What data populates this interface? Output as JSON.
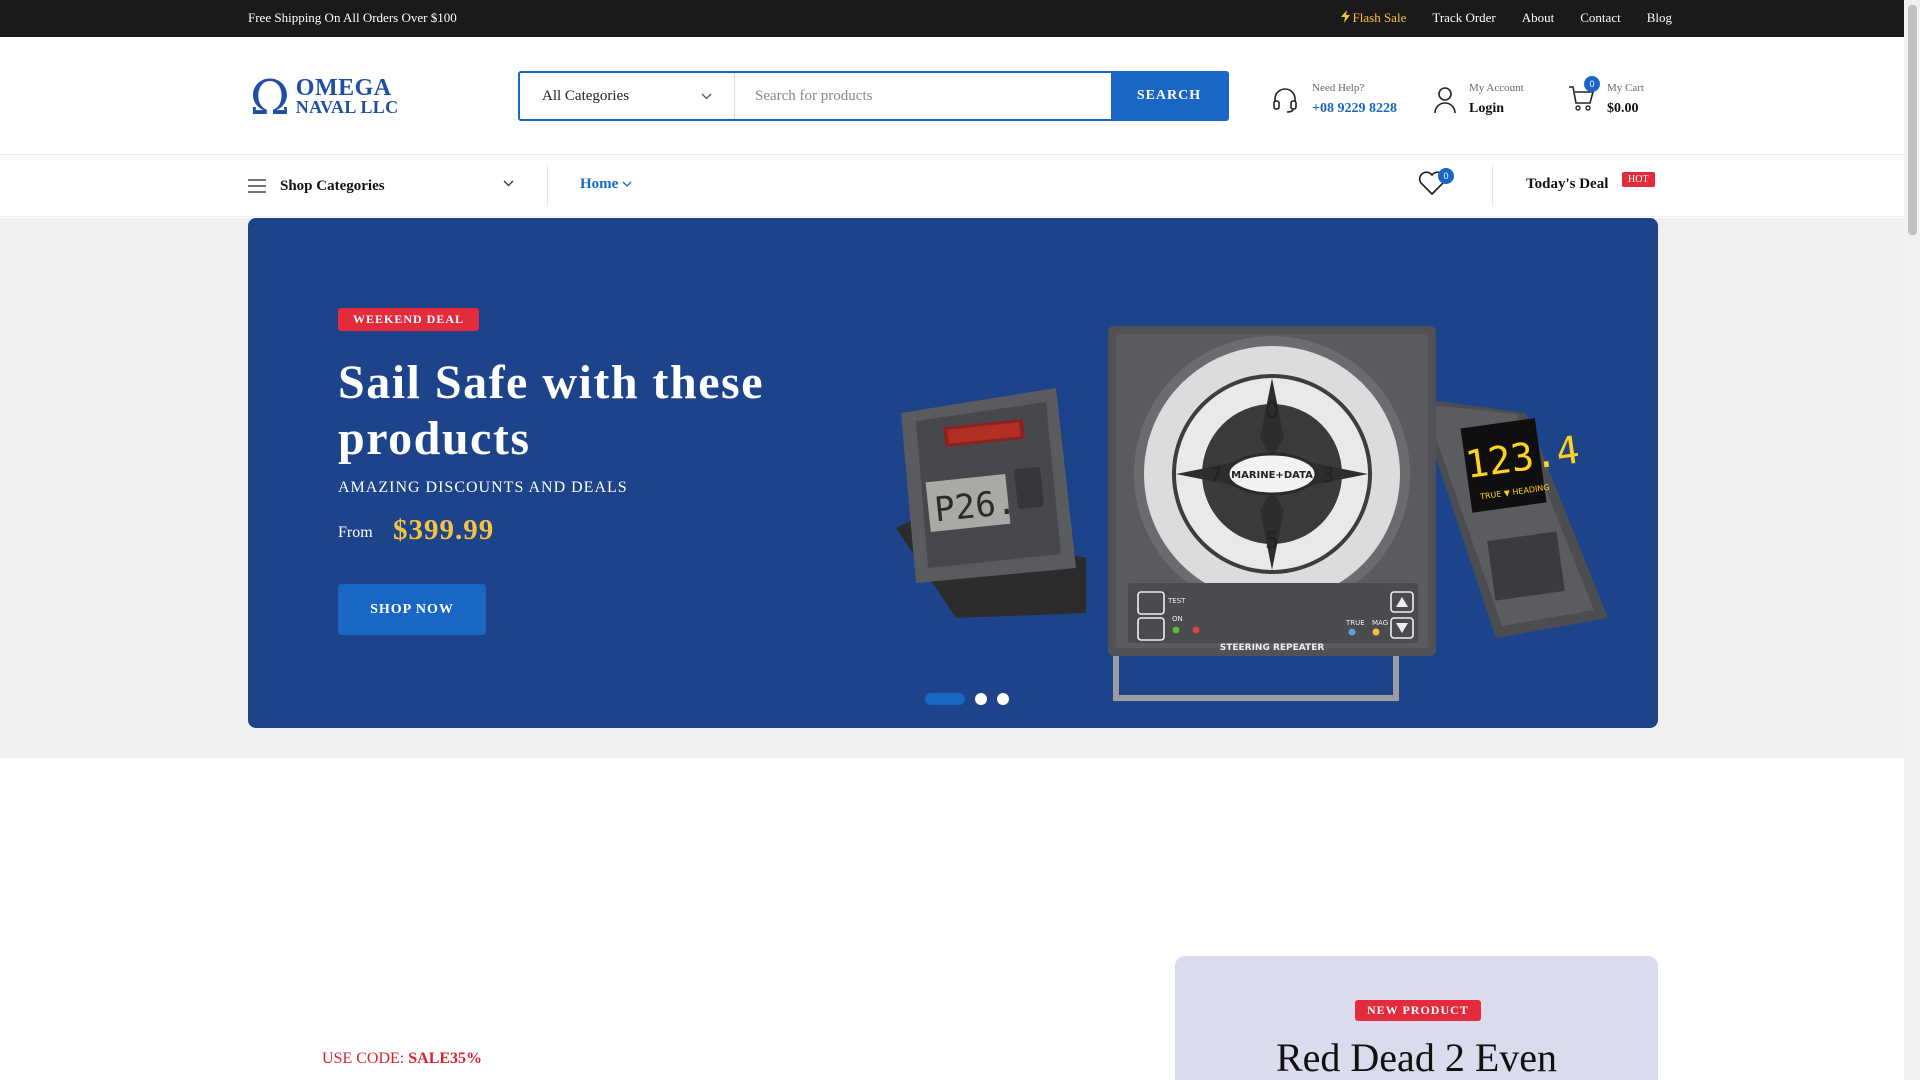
{
  "topbar": {
    "shipping": "Free Shipping On All Orders Over $100",
    "links": [
      "Flash Sale",
      "Track Order",
      "About",
      "Contact",
      "Blog"
    ]
  },
  "logo": {
    "line1": "OMEGA",
    "line2": "NAVAL LLC"
  },
  "search": {
    "category": "All Categories",
    "placeholder": "Search for products",
    "button": "SEARCH"
  },
  "help": {
    "label": "Need Help?",
    "phone": "+08 9229 8228"
  },
  "account": {
    "label": "My Account",
    "action": "Login"
  },
  "cart": {
    "label": "My Cart",
    "total": "$0.00",
    "count": "0"
  },
  "nav": {
    "shop_categories": "Shop Categories",
    "home": "Home",
    "wishlist_count": "0",
    "todays_deal": "Today's Deal",
    "hot": "HOT"
  },
  "hero": {
    "tag": "WEEKEND DEAL",
    "title": "Sail Safe with these products",
    "subtitle": "AMAZING DISCOUNTS AND DEALS",
    "from": "From",
    "price": "$399.99",
    "button": "SHOP NOW",
    "slide_count": 3,
    "active_slide": 1,
    "device": {
      "left_display": "P26.",
      "compass_brand": "MARINE+DATA",
      "compass_label": "STEERING REPEATER",
      "compass_test": "TEST",
      "compass_on": "ON",
      "compass_true": "TRUE",
      "compass_mag": "MAG",
      "right_display": "123.4",
      "right_sub": "TRUE ▼ HEADING"
    }
  },
  "promo": {
    "code_label": "USE CODE:",
    "code": "SALE35%"
  },
  "new_product": {
    "tag": "NEW PRODUCT",
    "title": "Red Dead 2 Even"
  },
  "colors": {
    "accent": "#1966c5",
    "hero_bg": "#1d448a",
    "sale_red": "#e32b3c",
    "price_gold": "#f5c242",
    "topbar": "#1a1a1a"
  }
}
